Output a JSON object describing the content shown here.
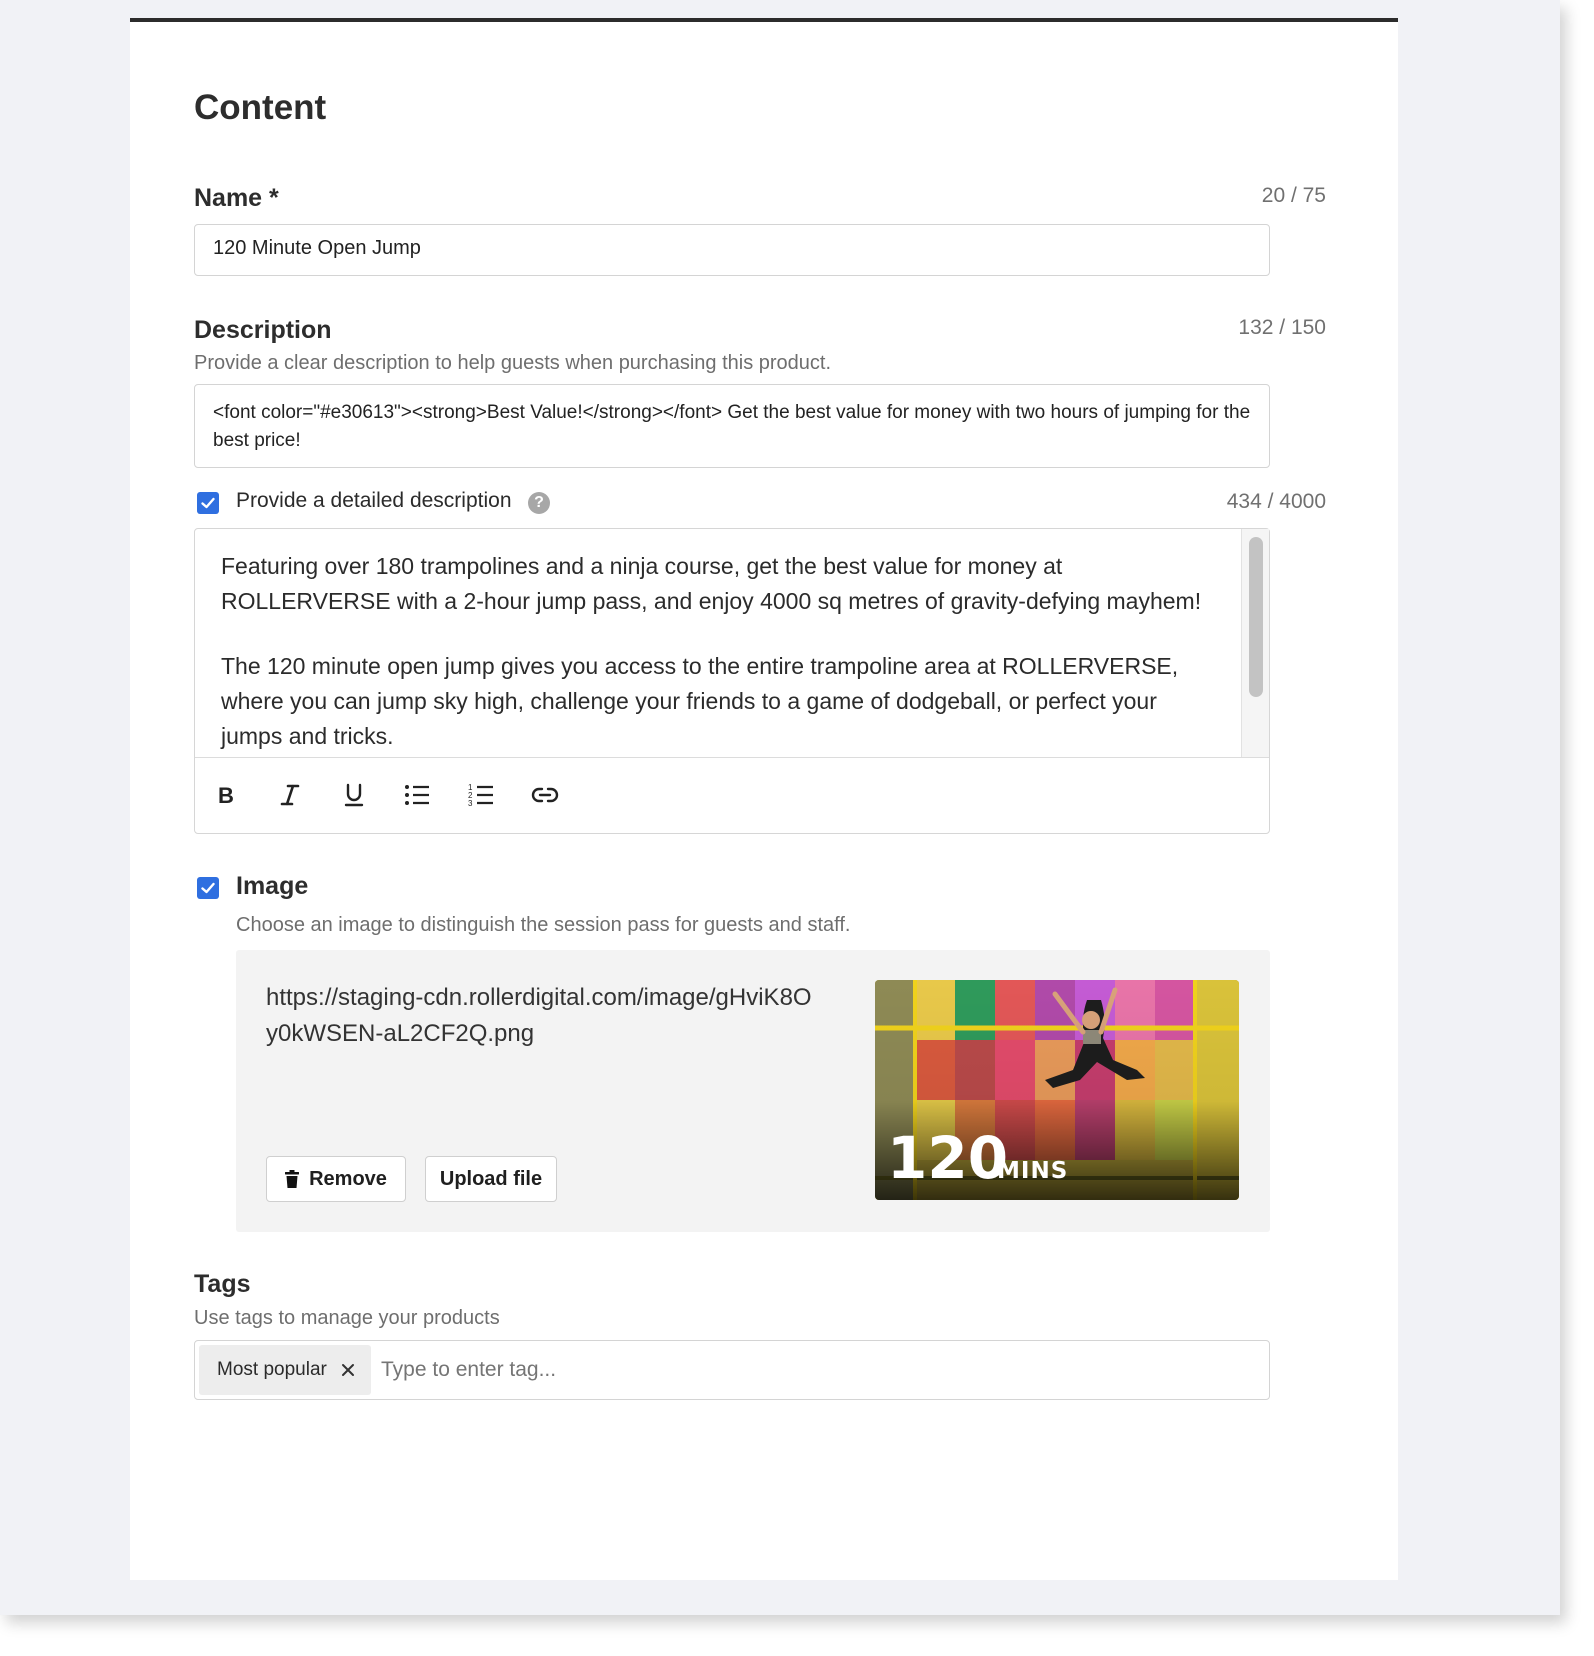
{
  "section": {
    "title": "Content"
  },
  "name": {
    "label": "Name *",
    "counter": "20 / 75",
    "value": "120 Minute Open Jump"
  },
  "description": {
    "label": "Description",
    "counter": "132 / 150",
    "helper": "Provide a clear description to help guests when purchasing this product.",
    "value": "<font color=\"#e30613\"><strong>Best Value!</strong></font> Get the best value for money with two hours of jumping for the best price!"
  },
  "detailed": {
    "checkbox_label": "Provide a detailed description",
    "checked": true,
    "counter": "434 / 4000",
    "paragraph1": "Featuring over 180 trampolines and a ninja course, get the best value for money at ROLLERVERSE with a 2-hour jump pass, and enjoy 4000 sq metres of gravity-defying mayhem!",
    "paragraph2": "The 120 minute open jump gives you access to the entire trampoline area at ROLLERVERSE, where you can jump sky high, challenge your friends to a game of dodgeball, or perfect your jumps and tricks.",
    "toolbar": [
      "bold-icon",
      "italic-icon",
      "underline-icon",
      "bulleted-list-icon",
      "numbered-list-icon",
      "link-icon"
    ]
  },
  "image": {
    "label": "Image",
    "checked": true,
    "helper": "Choose an image to distinguish the session pass for guests and staff.",
    "url_line1": "https://staging-cdn.rollerdigital.com/image/gHviK8O",
    "url_line2": "y0kWSEN-aL2CF2Q.png",
    "remove_label": "Remove",
    "upload_label": "Upload file",
    "preview_big": "120",
    "preview_small": "MINS"
  },
  "tags": {
    "label": "Tags",
    "helper": "Use tags to manage your products",
    "items": [
      "Most popular"
    ],
    "placeholder": "Type to enter tag..."
  },
  "colors": {
    "accent": "#2f6fe0",
    "page_bg": "#f1f2f6",
    "panel_bg": "#f3f3f3"
  }
}
